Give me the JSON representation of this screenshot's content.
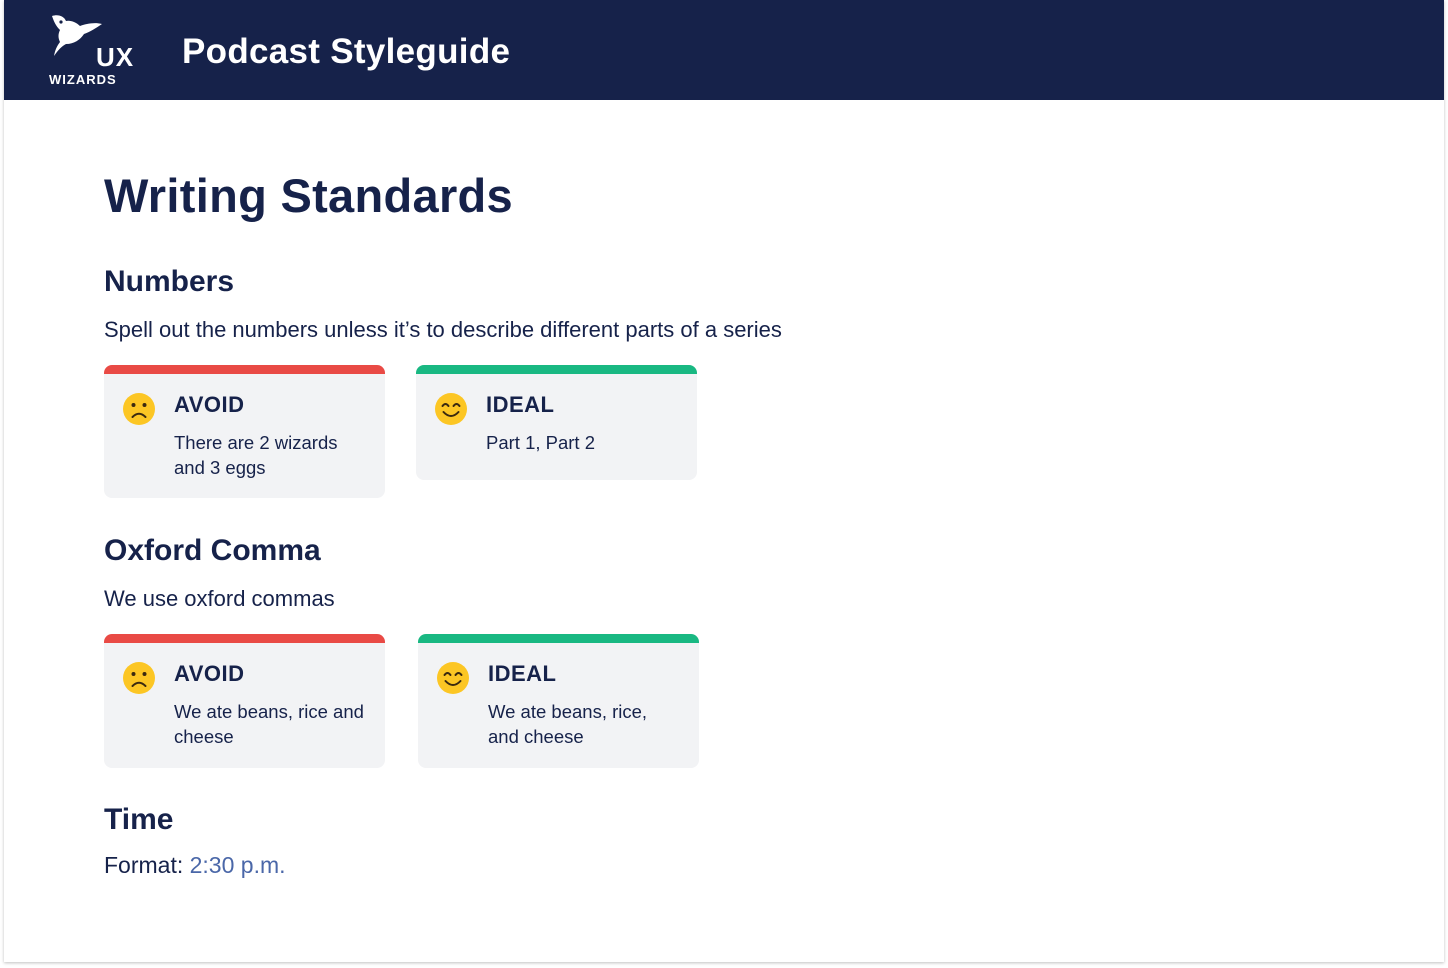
{
  "header": {
    "logo_top": "UX",
    "logo_bottom": "WIZARDS",
    "title": "Podcast Styleguide",
    "background": "#16224a"
  },
  "page": {
    "title": "Writing Standards"
  },
  "sections": {
    "numbers": {
      "title": "Numbers",
      "description": "Spell out the numbers unless it’s to describe different parts of a series",
      "avoid": {
        "label": "AVOID",
        "text": "There are 2 wizards and 3 eggs",
        "icon": "sad-face-icon"
      },
      "ideal": {
        "label": "IDEAL",
        "text": "Part 1, Part 2",
        "icon": "smile-face-icon"
      }
    },
    "oxford": {
      "title": "Oxford Comma",
      "description": "We use oxford commas",
      "avoid": {
        "label": "AVOID",
        "text": "We ate beans, rice and cheese",
        "icon": "sad-face-icon"
      },
      "ideal": {
        "label": "IDEAL",
        "text": "We ate beans, rice, and cheese",
        "icon": "smile-face-icon"
      }
    },
    "time": {
      "title": "Time",
      "format_label": "Format:",
      "format_value": "2:30 p.m."
    }
  },
  "colors": {
    "avoid_accent": "#e94a45",
    "ideal_accent": "#19b882",
    "card_bg": "#f2f3f5",
    "text": "#16224a",
    "link": "#4a67a8",
    "emoji": "#fcc624"
  }
}
